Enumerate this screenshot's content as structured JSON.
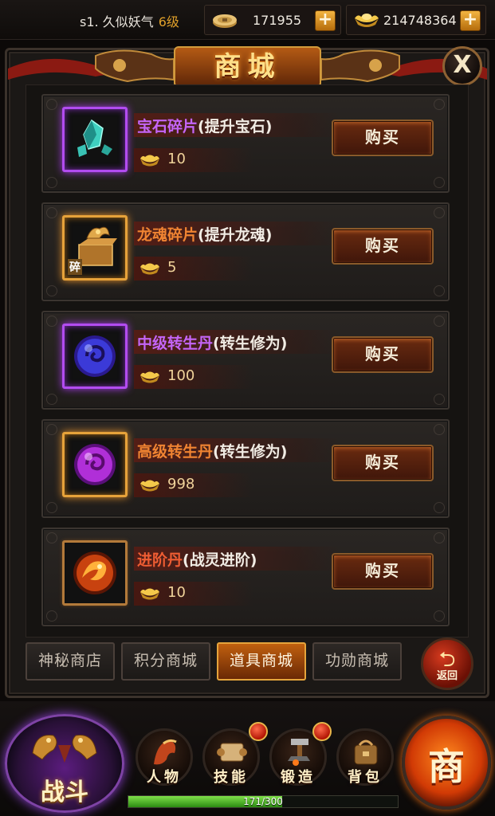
{
  "player": {
    "name": "s1. 久似妖气",
    "level": "6级"
  },
  "currency": {
    "gold": "171955",
    "ingot": "214748364",
    "add_label": "+"
  },
  "shop": {
    "title": "商城",
    "close_label": "X",
    "buy_label": "购买",
    "items": [
      {
        "name": "宝石碎片",
        "desc": "(提升宝石)",
        "price": "10",
        "name_color": "#c465f7",
        "frame": "purple",
        "icon": "gem-fragment-icon"
      },
      {
        "name": "龙魂碎片",
        "desc": "(提升龙魂)",
        "price": "5",
        "name_color": "#f08432",
        "frame": "gold",
        "icon": "dragon-soul-fragment-icon",
        "tag": "碎"
      },
      {
        "name": "中级转生丹",
        "desc": "(转生修为)",
        "price": "100",
        "name_color": "#c465f7",
        "frame": "purple",
        "icon": "blue-orb-icon"
      },
      {
        "name": "高级转生丹",
        "desc": "(转生修为)",
        "price": "998",
        "name_color": "#f08432",
        "frame": "gold",
        "icon": "purple-orb-icon"
      },
      {
        "name": "进阶丹",
        "desc": "(战灵进阶)",
        "price": "10",
        "name_color": "#ef5d33",
        "frame": "plain",
        "icon": "phoenix-orb-icon"
      }
    ],
    "tabs": [
      {
        "label": "神秘商店",
        "active": false
      },
      {
        "label": "积分商城",
        "active": false
      },
      {
        "label": "道具商城",
        "active": true
      },
      {
        "label": "功勋商城",
        "active": false
      }
    ],
    "back_label": "返回"
  },
  "hud": {
    "battle_label": "战斗",
    "buttons": [
      {
        "label": "人物",
        "icon": "character-icon",
        "badge": false
      },
      {
        "label": "技能",
        "icon": "skill-scroll-icon",
        "badge": true
      },
      {
        "label": "锻造",
        "icon": "forge-icon",
        "badge": true
      },
      {
        "label": "背包",
        "icon": "backpack-icon",
        "badge": false
      }
    ],
    "shop_label": "商",
    "xp_text": "171/300",
    "xp_fraction": 0.57
  },
  "colors": {
    "accent_gold": "#e6a23a",
    "rare_purple": "#c465f7",
    "epic_orange": "#f08432"
  }
}
